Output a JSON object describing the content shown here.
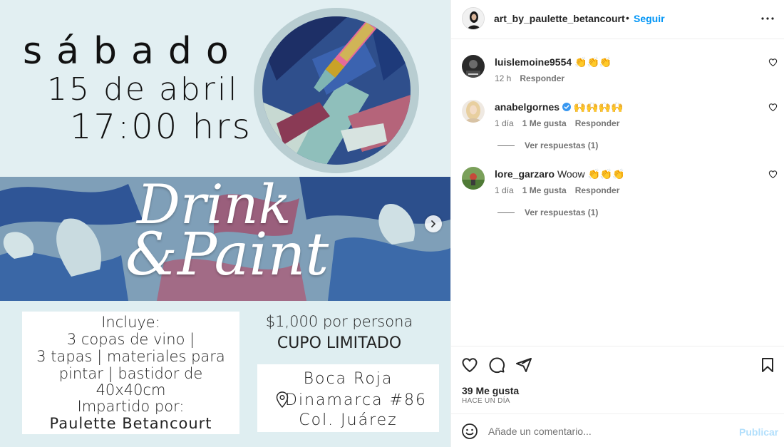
{
  "post": {
    "day": "sábado",
    "date": "15 de abril",
    "time": "17:00 hrs",
    "title_line1": "Drink",
    "title_line2": "&Paint",
    "includes_lines": [
      "Incluye:",
      "3 copas de vino |",
      "3 tapas | materiales para",
      "pintar | bastidor de",
      "40x40cm",
      "Impartido por:"
    ],
    "teacher": "Paulette Betancourt",
    "price": "$1,000 por persona",
    "capacity": "CUPO LIMITADO",
    "venue": "Boca Roja",
    "address": "Dinamarca #86",
    "colonia": "Col. Juárez"
  },
  "header": {
    "author": "art_by_paulette_betancourt",
    "separator": "•",
    "follow_label": "Seguir"
  },
  "comments": [
    {
      "user": "luislemoine9554",
      "text": "👏👏👏",
      "time": "12 h",
      "likes": "",
      "reply": "Responder",
      "view_replies": ""
    },
    {
      "user": "anabelgornes",
      "text": "🙌🙌🙌🙌",
      "time": "1 día",
      "likes": "1 Me gusta",
      "reply": "Responder",
      "view_replies": "Ver respuestas (1)",
      "verified": true
    },
    {
      "user": "lore_garzaro",
      "text": "Woow 👏👏👏",
      "time": "1 día",
      "likes": "1 Me gusta",
      "reply": "Responder",
      "view_replies": "Ver respuestas (1)"
    }
  ],
  "stats": {
    "likes": "39 Me gusta",
    "posted": "HACE UN DÍA"
  },
  "composer": {
    "placeholder": "Añade un comentario...",
    "publish_label": "Publicar"
  },
  "icons": {
    "more": "more-options-icon",
    "like": "heart-icon",
    "comment": "comment-icon",
    "share": "share-icon",
    "save": "bookmark-icon",
    "emoji": "emoji-icon",
    "next": "chevron-right-icon",
    "location": "location-pin-icon"
  },
  "colors": {
    "accent": "#0095f6",
    "publish_disabled": "#b2dffc",
    "meta": "#737373",
    "post_bg": "#e2eff2"
  }
}
